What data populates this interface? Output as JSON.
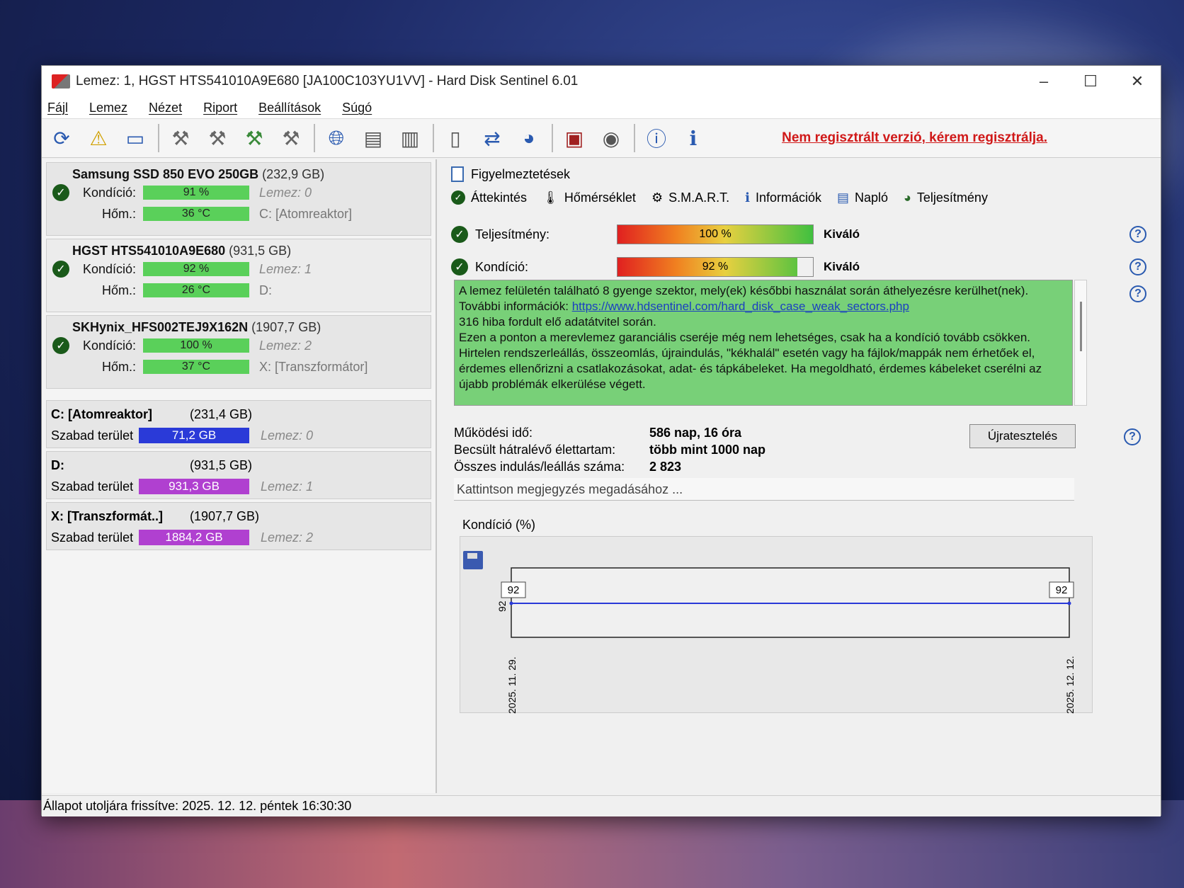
{
  "window": {
    "title": "Lemez: 1, HGST HTS541010A9E680 [JA100C103YU1VV]  -  Hard Disk Sentinel 6.01",
    "minimize": "–",
    "maximize": "☐",
    "close": "✕"
  },
  "menu": [
    "Fájl",
    "Lemez",
    "Nézet",
    "Riport",
    "Beállítások",
    "Súgó"
  ],
  "toolbar": {
    "register_link": "Nem regisztrált verzió, kérem regisztrálja."
  },
  "disks": [
    {
      "name": "Samsung SSD 850 EVO 250GB",
      "size": "(232,9 GB)",
      "cond_label": "Kondíció:",
      "cond": "91 %",
      "cond_value": 91,
      "disk_no": "Lemez: 0",
      "temp_label": "Hőm.:",
      "temp": "36 °C",
      "drive": "C: [Atomreaktor]"
    },
    {
      "name": "HGST HTS541010A9E680",
      "size": "(931,5 GB)",
      "cond_label": "Kondíció:",
      "cond": "92 %",
      "cond_value": 92,
      "disk_no": "Lemez: 1",
      "temp_label": "Hőm.:",
      "temp": "26 °C",
      "drive": "D:"
    },
    {
      "name": "SKHynix_HFS002TEJ9X162N",
      "size": "(1907,7 GB)",
      "cond_label": "Kondíció:",
      "cond": "100 %",
      "cond_value": 100,
      "disk_no": "Lemez: 2",
      "temp_label": "Hőm.:",
      "temp": "37 °C",
      "drive": "X: [Transzformátor]"
    }
  ],
  "partitions": [
    {
      "name": "C: [Atomreaktor]",
      "size": "(231,4 GB)",
      "free_label": "Szabad terület",
      "free": "71,2 GB",
      "disk_no": "Lemez: 0",
      "color": "#2a3ad8"
    },
    {
      "name": "D:",
      "size": "(931,5 GB)",
      "free_label": "Szabad terület",
      "free": "931,3 GB",
      "disk_no": "Lemez: 1",
      "color": "#b040d0"
    },
    {
      "name": "X: [Transzformát..]",
      "size": "(1907,7 GB)",
      "free_label": "Szabad terület",
      "free": "1884,2 GB",
      "disk_no": "Lemez: 2",
      "color": "#b040d0"
    }
  ],
  "warnings_header": "Figyelmeztetések",
  "tabs": [
    "Áttekintés",
    "Hőmérséklet",
    "S.M.A.R.T.",
    "Információk",
    "Napló",
    "Teljesítmény"
  ],
  "overview": {
    "perf_label": "Teljesítmény:",
    "perf_value": "100 %",
    "perf_fraction": 1.0,
    "perf_rating": "Kiváló",
    "cond_label": "Kondíció:",
    "cond_value": "92 %",
    "cond_fraction": 0.92,
    "cond_rating": "Kiváló",
    "message_l1": "A lemez felületén található 8 gyenge szektor, mely(ek) későbbi használat során áthelyezésre kerülhet(nek).",
    "message_l2_prefix": "További információk: ",
    "message_link": "https://www.hdsentinel.com/hard_disk_case_weak_sectors.php",
    "message_l3": "316 hiba fordult elő adatátvitel során.",
    "message_l4": "Ezen a ponton a merevlemez garanciális cseréje még nem lehetséges, csak ha a kondíció tovább csökken.",
    "message_l5": "Hirtelen rendszerleállás, összeomlás, újraindulás, \"kékhalál\" esetén vagy ha fájlok/mappák nem érhetőek el, érdemes ellenőrizni a csatlakozásokat, adat- és tápkábeleket. Ha megoldható, érdemes kábeleket cserélni az újabb problémák elkerülése végett.",
    "uptime_label": "Működési idő:",
    "uptime": "586 nap, 16 óra",
    "lifetime_label": "Becsült hátralévő élettartam:",
    "lifetime": "több mint 1000 nap",
    "starts_label": "Összes indulás/leállás száma:",
    "starts": "2 823",
    "retest_button": "Újratesztelés",
    "note_placeholder": "Kattintson megjegyzés megadásához ..."
  },
  "chart_data": {
    "type": "line",
    "title": "Kondíció  (%)",
    "x": [
      "2025. 11. 29.",
      "2025. 12. 12."
    ],
    "series": [
      {
        "values": [
          92,
          92
        ]
      }
    ],
    "ytick_label": "92",
    "point_labels": [
      "92",
      "92"
    ]
  },
  "status": "Állapot utoljára frissítve: 2025. 12. 12. péntek 16:30:30",
  "colors": {
    "accent": "#2a5ab0",
    "warning_bg": "#78d078",
    "link": "#d01818"
  }
}
